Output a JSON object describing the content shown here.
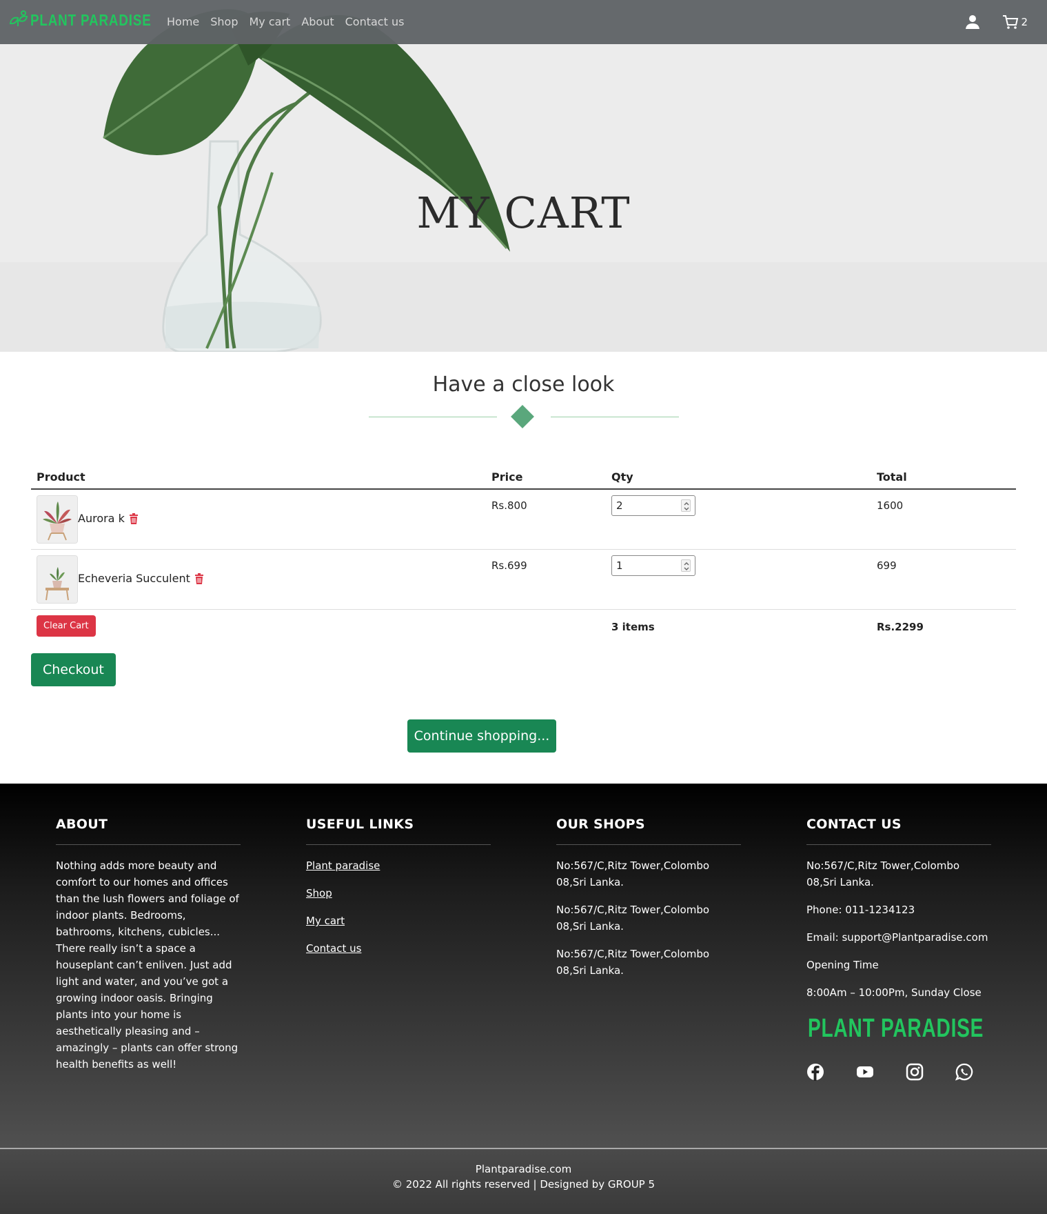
{
  "nav": {
    "brand": "PLANT PARADISE",
    "links": [
      "Home",
      "Shop",
      "My cart",
      "About",
      "Contact us"
    ],
    "cart_count": "2"
  },
  "hero": {
    "title": "MY CART"
  },
  "section": {
    "title": "Have a close look"
  },
  "cart": {
    "headers": {
      "product": "Product",
      "price": "Price",
      "qty": "Qty",
      "total": "Total"
    },
    "rows": [
      {
        "name": "Aurora k",
        "price": "Rs.800",
        "qty": "2",
        "total": "1600"
      },
      {
        "name": "Echeveria Succulent",
        "price": "Rs.699",
        "qty": "1",
        "total": "699"
      }
    ],
    "clear_label": "Clear Cart",
    "items_label": "3 items",
    "grand_total": "Rs.2299",
    "checkout_label": "Checkout",
    "continue_label": "Continue shopping..."
  },
  "footer": {
    "about": {
      "title": "ABOUT",
      "text": "Nothing adds more beauty and comfort to our homes and offices than the lush flowers and foliage of indoor plants. Bedrooms, bathrooms, kitchens, cubicles... There really isn’t a space a houseplant can’t enliven. Just add light and water, and you’ve got a growing indoor oasis. Bringing plants into your home is aesthetically pleasing and – amazingly – plants can offer strong health benefits as well!"
    },
    "links": {
      "title": "USEFUL LINKS",
      "items": [
        "Plant paradise",
        "Shop",
        "My cart",
        "Contact us"
      ]
    },
    "shops": {
      "title": "OUR SHOPS",
      "items": [
        "No:567/C,Ritz Tower,Colombo 08,Sri Lanka.",
        "No:567/C,Ritz Tower,Colombo 08,Sri Lanka.",
        "No:567/C,Ritz Tower,Colombo 08,Sri Lanka."
      ]
    },
    "contact": {
      "title": "CONTACT US",
      "address": "No:567/C,Ritz Tower,Colombo 08,Sri Lanka.",
      "phone": "Phone: 011-1234123",
      "email": "Email: support@Plantparadise.com",
      "opening_label": "Opening Time",
      "hours": "8:00Am – 10:00Pm, Sunday Close",
      "logo_text": "PLANT PARADISE"
    },
    "socials": [
      "facebook-icon",
      "youtube-icon",
      "instagram-icon",
      "whatsapp-icon"
    ],
    "site": "Plantparadise.com",
    "copyright": "© 2022 All rights reserved | Designed by GROUP 5"
  },
  "colors": {
    "brand_green": "#22c55e",
    "button_green": "#198754",
    "danger": "#dc3545",
    "diamond": "#5aa77c"
  }
}
